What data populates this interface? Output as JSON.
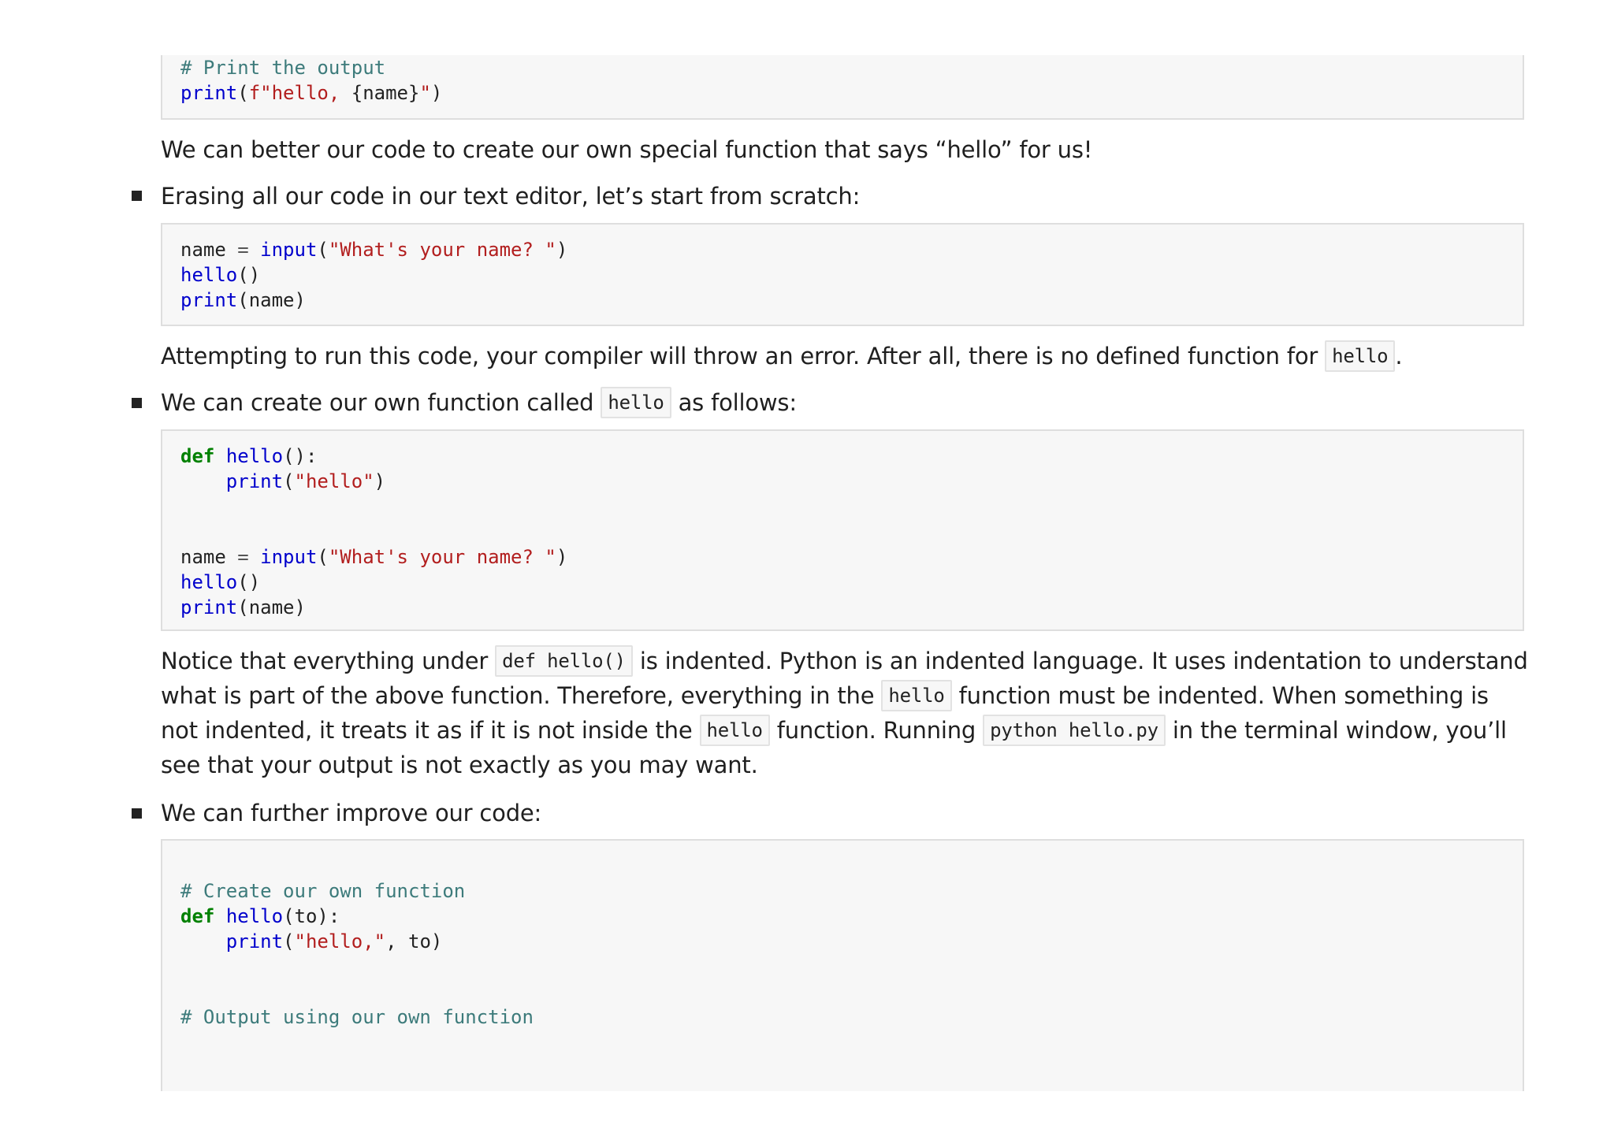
{
  "blocks": {
    "code_top": {
      "lines": [
        [
          {
            "t": "comment",
            "v": "# Print the output"
          }
        ],
        [
          {
            "t": "builtin",
            "v": "print"
          },
          {
            "t": "plain",
            "v": "("
          },
          {
            "t": "string",
            "v": "f\"hello, "
          },
          {
            "t": "plain",
            "v": "{name}"
          },
          {
            "t": "string",
            "v": "\""
          },
          {
            "t": "plain",
            "v": ")"
          }
        ]
      ]
    },
    "para_better": "We can better our code to create our own special function that says “hello” for us!",
    "bullet_erasing": "Erasing all our code in our text editor, let’s start from scratch:",
    "code_scratch": {
      "lines": [
        [
          {
            "t": "plain",
            "v": "name "
          },
          {
            "t": "op",
            "v": "="
          },
          {
            "t": "plain",
            "v": " "
          },
          {
            "t": "builtin",
            "v": "input"
          },
          {
            "t": "plain",
            "v": "("
          },
          {
            "t": "string",
            "v": "\"What's your name? \""
          },
          {
            "t": "plain",
            "v": ")"
          }
        ],
        [
          {
            "t": "func",
            "v": "hello"
          },
          {
            "t": "plain",
            "v": "()"
          }
        ],
        [
          {
            "t": "builtin",
            "v": "print"
          },
          {
            "t": "plain",
            "v": "(name)"
          }
        ]
      ]
    },
    "para_attempt": {
      "before": "Attempting to run this code, your compiler will throw an error. After all, there is no defined function for ",
      "code": "hello",
      "after": "."
    },
    "bullet_create": {
      "before": "We can create our own function called ",
      "code": "hello",
      "after": " as follows:"
    },
    "code_def": {
      "lines": [
        [
          {
            "t": "keyword",
            "v": "def"
          },
          {
            "t": "plain",
            "v": " "
          },
          {
            "t": "func",
            "v": "hello"
          },
          {
            "t": "plain",
            "v": "():"
          }
        ],
        [
          {
            "t": "plain",
            "v": "    "
          },
          {
            "t": "builtin",
            "v": "print"
          },
          {
            "t": "plain",
            "v": "("
          },
          {
            "t": "string",
            "v": "\"hello\""
          },
          {
            "t": "plain",
            "v": ")"
          }
        ],
        [],
        [],
        [
          {
            "t": "plain",
            "v": "name "
          },
          {
            "t": "op",
            "v": "="
          },
          {
            "t": "plain",
            "v": " "
          },
          {
            "t": "builtin",
            "v": "input"
          },
          {
            "t": "plain",
            "v": "("
          },
          {
            "t": "string",
            "v": "\"What's your name? \""
          },
          {
            "t": "plain",
            "v": ")"
          }
        ],
        [
          {
            "t": "func",
            "v": "hello"
          },
          {
            "t": "plain",
            "v": "()"
          }
        ],
        [
          {
            "t": "builtin",
            "v": "print"
          },
          {
            "t": "plain",
            "v": "(name)"
          }
        ]
      ]
    },
    "para_notice": {
      "s1": "Notice that everything under ",
      "c1": "def hello()",
      "s2": " is indented. Python is an indented language. It uses indentation to understand what is part of the above function. Therefore, everything in the ",
      "c2": "hello",
      "s3": " function must be indented. When something is not indented, it treats it as if it is not inside the ",
      "c3": "hello",
      "s4": " function. Running ",
      "c4": "python hello.py",
      "s5": " in the terminal window, you’ll see that your output is not exactly as you may want."
    },
    "bullet_improve": "We can further improve our code:",
    "code_improve": {
      "lines": [
        [],
        [
          {
            "t": "comment",
            "v": "# Create our own function"
          }
        ],
        [
          {
            "t": "keyword",
            "v": "def"
          },
          {
            "t": "plain",
            "v": " "
          },
          {
            "t": "func",
            "v": "hello"
          },
          {
            "t": "plain",
            "v": "(to):"
          }
        ],
        [
          {
            "t": "plain",
            "v": "    "
          },
          {
            "t": "builtin",
            "v": "print"
          },
          {
            "t": "plain",
            "v": "("
          },
          {
            "t": "string",
            "v": "\"hello,\""
          },
          {
            "t": "plain",
            "v": ", to)"
          }
        ],
        [],
        [],
        [
          {
            "t": "comment",
            "v": "# Output using our own function"
          }
        ]
      ]
    }
  },
  "icons": {
    "bullet": "square-bullet-icon"
  },
  "colors": {
    "comment": "#3d7b7b",
    "builtin": "#0000cc",
    "keyword": "#008000",
    "string": "#b21e1e",
    "code_bg": "#f7f7f7",
    "code_border": "#dedede"
  }
}
